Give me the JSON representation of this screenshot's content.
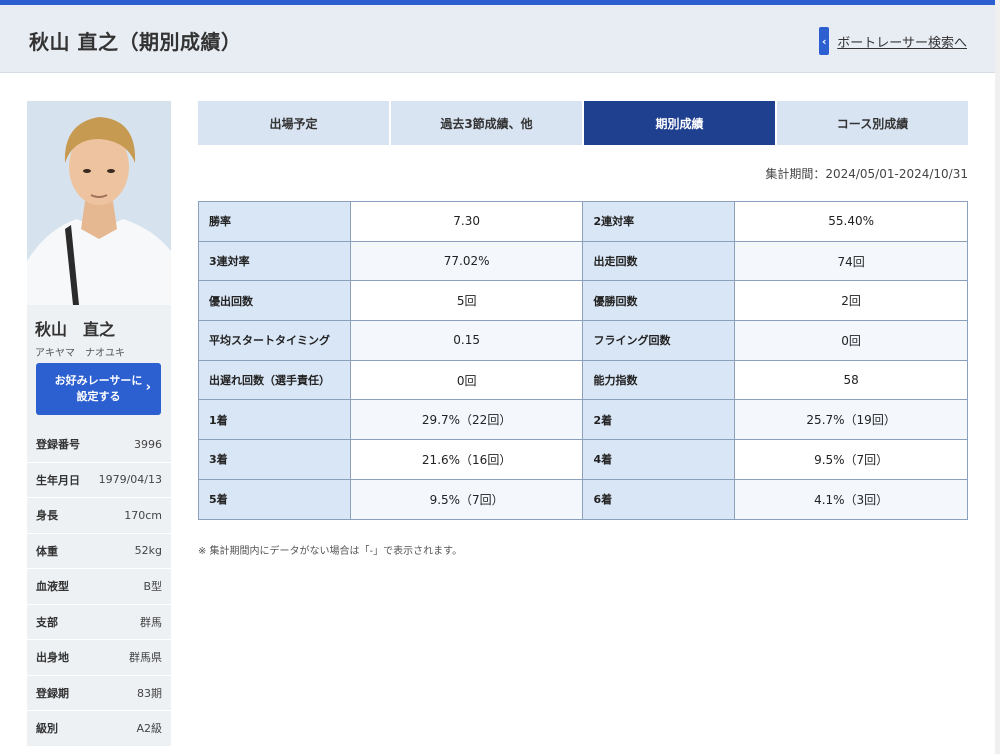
{
  "header": {
    "title": "秋山 直之（期別成績）",
    "search_link": "ボートレーサー検索へ"
  },
  "profile": {
    "name_kanji": "秋山　直之",
    "name_kana": "アキヤマ　ナオユキ",
    "favorite_button": "お好みレーサーに\n設定する",
    "rows": [
      {
        "label": "登録番号",
        "value": "3996"
      },
      {
        "label": "生年月日",
        "value": "1979/04/13"
      },
      {
        "label": "身長",
        "value": "170cm"
      },
      {
        "label": "体重",
        "value": "52kg"
      },
      {
        "label": "血液型",
        "value": "B型"
      },
      {
        "label": "支部",
        "value": "群馬"
      },
      {
        "label": "出身地",
        "value": "群馬県"
      },
      {
        "label": "登録期",
        "value": "83期"
      },
      {
        "label": "級別",
        "value": "A2級"
      }
    ]
  },
  "tabs": [
    {
      "label": "出場予定",
      "active": false
    },
    {
      "label": "過去3節成績、他",
      "active": false
    },
    {
      "label": "期別成績",
      "active": true
    },
    {
      "label": "コース別成績",
      "active": false
    }
  ],
  "period": "集計期間：2024/05/01-2024/10/31",
  "stats": [
    [
      {
        "label": "勝率",
        "value": "7.30"
      },
      {
        "label": "2連対率",
        "value": "55.40%"
      }
    ],
    [
      {
        "label": "3連対率",
        "value": "77.02%"
      },
      {
        "label": "出走回数",
        "value": "74回"
      }
    ],
    [
      {
        "label": "優出回数",
        "value": "5回"
      },
      {
        "label": "優勝回数",
        "value": "2回"
      }
    ],
    [
      {
        "label": "平均スタートタイミング",
        "value": "0.15"
      },
      {
        "label": "フライング回数",
        "value": "0回"
      }
    ],
    [
      {
        "label": "出遅れ回数（選手責任）",
        "value": "0回"
      },
      {
        "label": "能力指数",
        "value": "58"
      }
    ],
    [
      {
        "label": "1着",
        "value": "29.7%（22回）"
      },
      {
        "label": "2着",
        "value": "25.7%（19回）"
      }
    ],
    [
      {
        "label": "3着",
        "value": "21.6%（16回）"
      },
      {
        "label": "4着",
        "value": "9.5%（7回）"
      }
    ],
    [
      {
        "label": "5着",
        "value": "9.5%（7回）"
      },
      {
        "label": "6着",
        "value": "4.1%（3回）"
      }
    ]
  ],
  "note": "※ 集計期間内にデータがない場合は「-」で表示されます。"
}
